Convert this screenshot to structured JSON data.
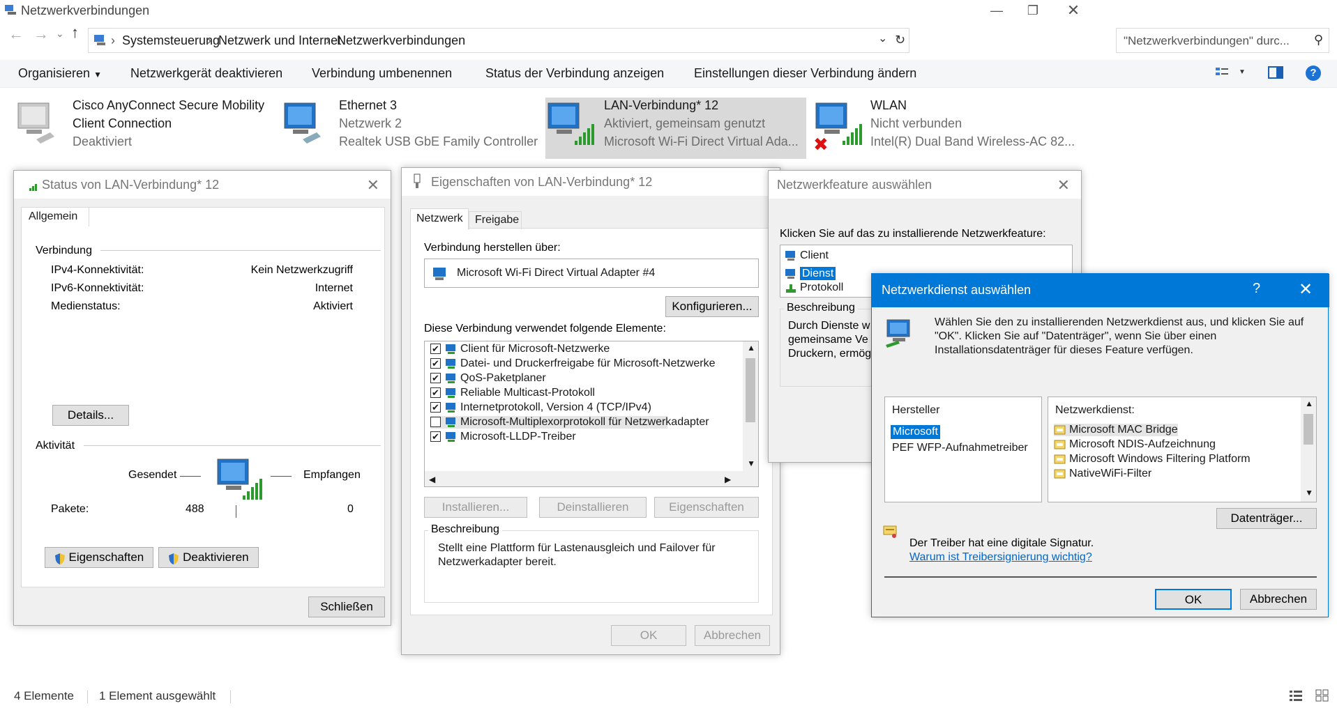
{
  "window": {
    "title": "Netzwerkverbindungen"
  },
  "address": {
    "crumbs": [
      "Systemsteuerung",
      "Netzwerk und Internet",
      "Netzwerkverbindungen"
    ],
    "search_placeholder": "\"Netzwerkverbindungen\" durc..."
  },
  "toolbar": {
    "organize": "Organisieren",
    "disable": "Netzwerkgerät deaktivieren",
    "rename": "Verbindung umbenennen",
    "status": "Status der Verbindung anzeigen",
    "settings": "Einstellungen dieser Verbindung ändern"
  },
  "connections": [
    {
      "name": "Cisco AnyConnect Secure Mobility",
      "name2": "Client Connection",
      "line2": "",
      "line3": "Deaktiviert"
    },
    {
      "name": "Ethernet 3",
      "name2": "",
      "line2": "Netzwerk 2",
      "line3": "Realtek USB GbE Family Controller"
    },
    {
      "name": "LAN-Verbindung* 12",
      "name2": "",
      "line2": "Aktiviert, gemeinsam genutzt",
      "line3": "Microsoft Wi-Fi Direct Virtual Ada..."
    },
    {
      "name": "WLAN",
      "name2": "",
      "line2": "Nicht verbunden",
      "line3": "Intel(R) Dual Band Wireless-AC 82..."
    }
  ],
  "status_dialog": {
    "title": "Status von LAN-Verbindung* 12",
    "tab": "Allgemein",
    "section_connection": "Verbindung",
    "rows": [
      {
        "label": "IPv4-Konnektivität:",
        "value": "Kein Netzwerkzugriff"
      },
      {
        "label": "IPv6-Konnektivität:",
        "value": "Internet"
      },
      {
        "label": "Medienstatus:",
        "value": "Aktiviert"
      }
    ],
    "details": "Details...",
    "section_activity": "Aktivität",
    "sent": "Gesendet",
    "received": "Empfangen",
    "packets_label": "Pakete:",
    "packets_sent": "488",
    "packets_received": "0",
    "properties": "Eigenschaften",
    "disable": "Deaktivieren",
    "close": "Schließen"
  },
  "props_dialog": {
    "title": "Eigenschaften von LAN-Verbindung* 12",
    "tabs": [
      "Netzwerk",
      "Freigabe"
    ],
    "connect_via": "Verbindung herstellen über:",
    "adapter": "Microsoft Wi-Fi Direct Virtual Adapter #4",
    "configure": "Konfigurieren...",
    "uses_label": "Diese Verbindung verwendet folgende Elemente:",
    "items": [
      {
        "label": "Client für Microsoft-Netzwerke",
        "checked": true
      },
      {
        "label": "Datei- und Druckerfreigabe für Microsoft-Netzwerke",
        "checked": true
      },
      {
        "label": "QoS-Paketplaner",
        "checked": true
      },
      {
        "label": "Reliable Multicast-Protokoll",
        "checked": true
      },
      {
        "label": "Internetprotokoll, Version 4 (TCP/IPv4)",
        "checked": true
      },
      {
        "label": "Microsoft-Multiplexorprotokoll für Netzwerkadapter",
        "checked": false
      },
      {
        "label": "Microsoft-LLDP-Treiber",
        "checked": true
      }
    ],
    "install": "Installieren...",
    "uninstall": "Deinstallieren",
    "properties": "Eigenschaften",
    "description_title": "Beschreibung",
    "description": "Stellt eine Plattform für Lastenausgleich und Failover für Netzwerkadapter bereit.",
    "ok": "OK",
    "cancel": "Abbrechen"
  },
  "feature_dialog": {
    "title": "Netzwerkfeature auswählen",
    "prompt": "Klicken Sie auf das zu installierende Netzwerkfeature:",
    "items": [
      "Client",
      "Dienst",
      "Protokoll"
    ],
    "description_title": "Beschreibung",
    "description_lines": [
      "Durch Dienste w",
      "gemeinsame Ve",
      "Druckern, ermög"
    ]
  },
  "service_dialog": {
    "title": "Netzwerkdienst auswählen",
    "help": "?",
    "intro": "Wählen Sie den zu installierenden Netzwerkdienst aus, und klicken Sie auf \"OK\". Klicken Sie auf \"Datenträger\", wenn Sie über einen Installationsdatenträger für dieses Feature verfügen.",
    "manufacturer_header": "Hersteller",
    "manufacturers": [
      "Microsoft",
      "PEF WFP-Aufnahmetreiber"
    ],
    "service_header": "Netzwerkdienst:",
    "services": [
      "Microsoft MAC Bridge",
      "Microsoft NDIS-Aufzeichnung",
      "Microsoft Windows Filtering Platform",
      "NativeWiFi-Filter"
    ],
    "disk": "Datenträger...",
    "signed": "Der Treiber hat eine digitale Signatur.",
    "why_link": "Warum ist Treibersignierung wichtig?",
    "ok": "OK",
    "cancel": "Abbrechen"
  },
  "statusbar": {
    "count": "4 Elemente",
    "selected": "1 Element ausgewählt"
  },
  "colors": {
    "accent": "#0078d7",
    "selection": "#cce8ff",
    "link": "#0066cc"
  }
}
